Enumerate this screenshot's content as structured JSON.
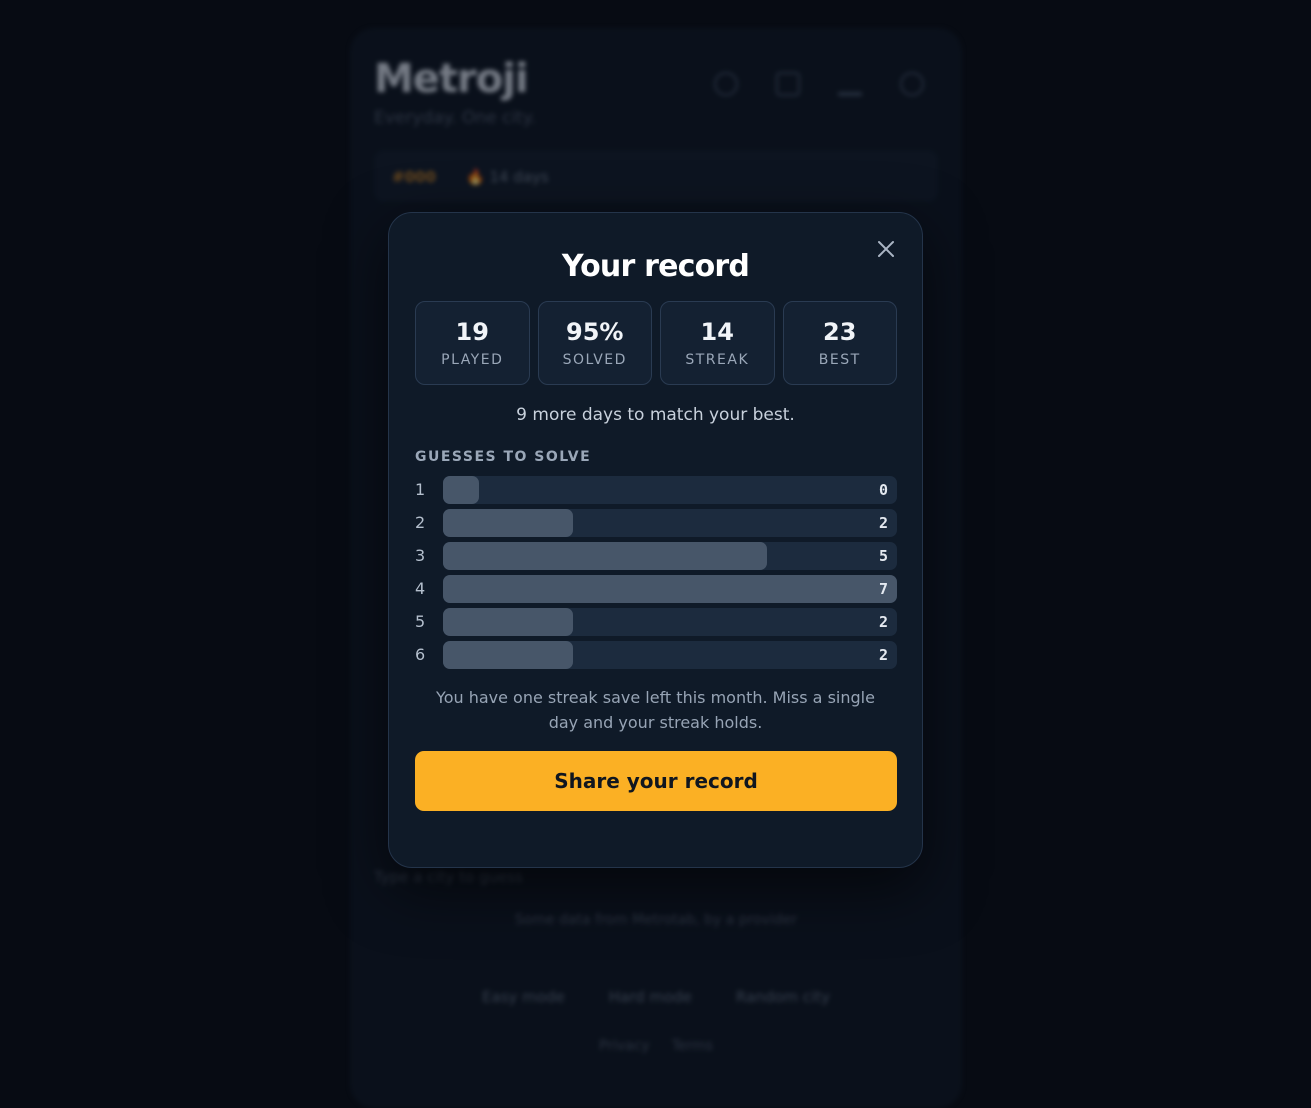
{
  "background_app": {
    "title": "Metroji",
    "subtitle": "Everyday. One city.",
    "puzzle_number": "#000",
    "streak_text": "14 days",
    "hint": "Type a city to guess",
    "credit": "Some data from Metrotab, by a provider",
    "footer_links": [
      "Easy mode",
      "Hard mode",
      "Random city"
    ],
    "footer_links_small": [
      "Privacy",
      "Terms"
    ]
  },
  "modal": {
    "title": "Your record",
    "stats": [
      {
        "value": "19",
        "label": "PLAYED"
      },
      {
        "value": "95%",
        "label": "SOLVED"
      },
      {
        "value": "14",
        "label": "STREAK"
      },
      {
        "value": "23",
        "label": "BEST"
      }
    ],
    "note": "9 more days to match your best.",
    "distribution_label": "GUESSES TO SOLVE",
    "distribution": [
      {
        "guess": "1",
        "count": 0
      },
      {
        "guess": "2",
        "count": 2
      },
      {
        "guess": "3",
        "count": 5
      },
      {
        "guess": "4",
        "count": 7
      },
      {
        "guess": "5",
        "count": 2
      },
      {
        "guess": "6",
        "count": 2
      }
    ],
    "streak_save_note": "You have one streak save left this month. Miss a single day and your streak holds.",
    "share_label": "Share your record",
    "close_icon": "close-icon"
  },
  "colors": {
    "accent": "#fbb024",
    "bar_fill": "#475669",
    "bar_track": "#1c2b3e"
  }
}
